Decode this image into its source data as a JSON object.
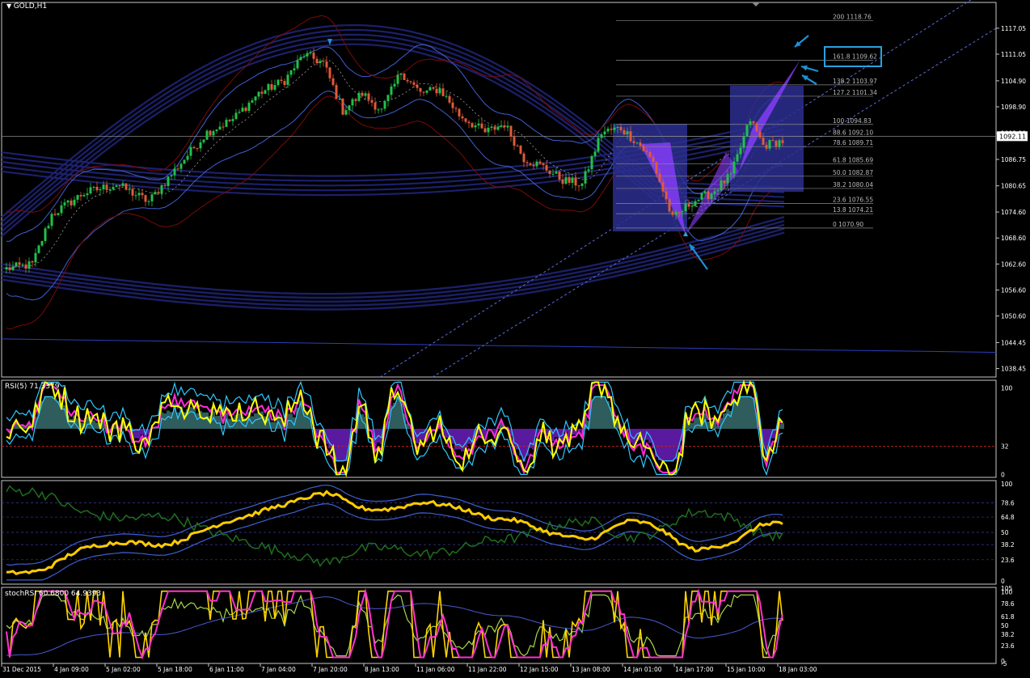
{
  "chart_title": "GOLD,H1",
  "current_price": "1092.11",
  "colors": {
    "background": "#000000",
    "frame": "#c8c8c8",
    "bull": "#22c04a",
    "bear": "#e05a3a",
    "band": "#1e2270",
    "bollinger": "#3f5fd0",
    "envelope_red": "#7a0a0a",
    "fibo": "#8a8a8a",
    "channel": "#5a6ee0",
    "zone": "#2b2f8f",
    "pattern": "#8a3dff",
    "arrow": "#1e90d6",
    "rsi_yellow": "#ffff00",
    "rsi_cyan": "#2ec8ff",
    "rsi_magenta": "#ff2bd6",
    "hist_teal": "#2f5c5c",
    "hist_purple": "#5a1aa0",
    "ind2_yellow": "#ffcc00",
    "ind2_green": "#1f6e1f",
    "stoch_magenta": "#ff30d0",
    "stoch_yellow": "#ffd400",
    "stoch_lime": "#a8d84a"
  },
  "price_axis": {
    "ticks": [
      "1117.05",
      "1111.05",
      "1104.90",
      "1098.90",
      "1092.80",
      "1086.75",
      "1080.65",
      "1074.60",
      "1068.60",
      "1062.60",
      "1056.60",
      "1050.60",
      "1044.45",
      "1038.45"
    ]
  },
  "time_axis": {
    "ticks": [
      "31 Dec 2015",
      "4 Jan 09:00",
      "5 Jan 02:00",
      "5 Jan 18:00",
      "6 Jan 11:00",
      "7 Jan 04:00",
      "7 Jan 20:00",
      "8 Jan 13:00",
      "11 Jan 06:00",
      "11 Jan 22:00",
      "12 Jan 15:00",
      "13 Jan 08:00",
      "14 Jan 01:00",
      "14 Jan 17:00",
      "15 Jan 10:00",
      "18 Jan 03:00"
    ]
  },
  "fibo_levels": [
    {
      "label": "200 1118.76",
      "value": 1118.76
    },
    {
      "label": "161.8 1109.62",
      "value": 1109.62
    },
    {
      "label": "138.2 1103.97",
      "value": 1103.97
    },
    {
      "label": "127.2 1101.34",
      "value": 1101.34
    },
    {
      "label": "100 1094.83",
      "value": 1094.83
    },
    {
      "label": "88.6 1092.10",
      "value": 1092.1
    },
    {
      "label": "78.6 1089.71",
      "value": 1089.71
    },
    {
      "label": "61.8 1085.69",
      "value": 1085.69
    },
    {
      "label": "50.0 1082.87",
      "value": 1082.87
    },
    {
      "label": "38.2 1080.04",
      "value": 1080.04
    },
    {
      "label": "23.6 1076.55",
      "value": 1076.55
    },
    {
      "label": "13.8 1074.21",
      "value": 1074.21
    },
    {
      "label": "0 1070.90",
      "value": 1070.9
    }
  ],
  "rsi_panel": {
    "label": "RSI(5) 71.3379",
    "ticks": [
      "100",
      "32",
      "0"
    ]
  },
  "ind2_panel": {
    "ticks": [
      "100",
      "78.6",
      "64.8",
      "50",
      "38.2",
      "23.6",
      "0"
    ]
  },
  "stoch_panel": {
    "label": "stochRSI 60.6800 64.9393",
    "ticks": [
      "105",
      "100",
      "78.6",
      "61.8",
      "50",
      "38.2",
      "23.6",
      "0",
      "-5"
    ]
  },
  "chart_data": {
    "type": "candlestick",
    "title": "GOLD,H1",
    "ylim": [
      1036.5,
      1123
    ],
    "x_range": [
      "31 Dec 2015",
      "18 Jan 03:00"
    ],
    "trend_keypoints": [
      {
        "i": 0,
        "p": 1061.5
      },
      {
        "i": 8,
        "p": 1062.5
      },
      {
        "i": 14,
        "p": 1074
      },
      {
        "i": 24,
        "p": 1079
      },
      {
        "i": 34,
        "p": 1081
      },
      {
        "i": 44,
        "p": 1077
      },
      {
        "i": 54,
        "p": 1086
      },
      {
        "i": 62,
        "p": 1093
      },
      {
        "i": 70,
        "p": 1096
      },
      {
        "i": 78,
        "p": 1102
      },
      {
        "i": 86,
        "p": 1105
      },
      {
        "i": 92,
        "p": 1111
      },
      {
        "i": 98,
        "p": 1109
      },
      {
        "i": 104,
        "p": 1098
      },
      {
        "i": 110,
        "p": 1102
      },
      {
        "i": 116,
        "p": 1098
      },
      {
        "i": 122,
        "p": 1107
      },
      {
        "i": 128,
        "p": 1102
      },
      {
        "i": 134,
        "p": 1103
      },
      {
        "i": 140,
        "p": 1097
      },
      {
        "i": 148,
        "p": 1093
      },
      {
        "i": 154,
        "p": 1095
      },
      {
        "i": 160,
        "p": 1087
      },
      {
        "i": 166,
        "p": 1085
      },
      {
        "i": 172,
        "p": 1082
      },
      {
        "i": 178,
        "p": 1081
      },
      {
        "i": 184,
        "p": 1093
      },
      {
        "i": 190,
        "p": 1094
      },
      {
        "i": 196,
        "p": 1090
      },
      {
        "i": 200,
        "p": 1086
      },
      {
        "i": 206,
        "p": 1073
      },
      {
        "i": 212,
        "p": 1077
      },
      {
        "i": 218,
        "p": 1079
      },
      {
        "i": 224,
        "p": 1083
      },
      {
        "i": 230,
        "p": 1096
      },
      {
        "i": 234,
        "p": 1090
      },
      {
        "i": 240,
        "p": 1091
      }
    ],
    "candle_count": 241
  }
}
